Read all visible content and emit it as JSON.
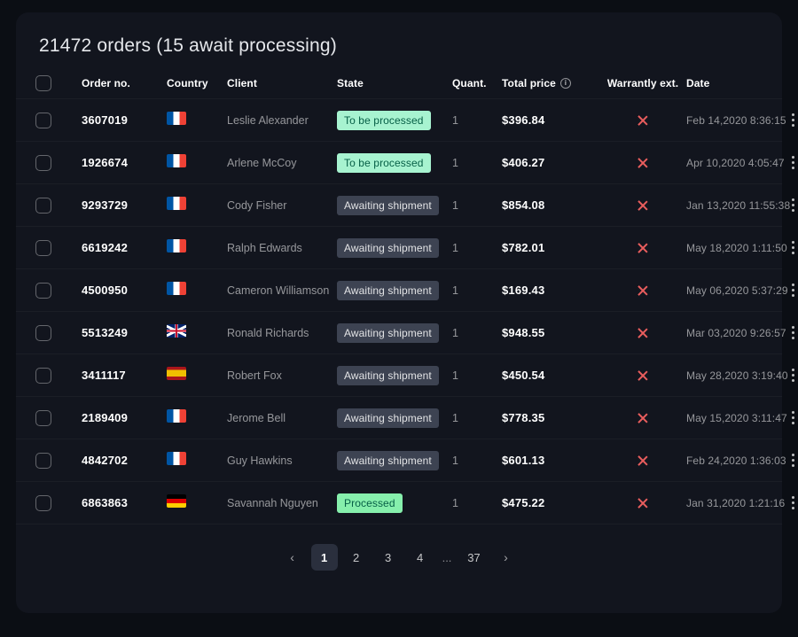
{
  "title": "21472 orders (15 await processing)",
  "columns": {
    "order_no": "Order no.",
    "country": "Country",
    "client": "Client",
    "state": "State",
    "quant": "Quant.",
    "total_price": "Total price",
    "warranty": "Warrantly ext.",
    "date": "Date"
  },
  "state_labels": {
    "to_be_processed": "To be processed",
    "awaiting": "Awaiting shipment",
    "processed": "Processed"
  },
  "rows": [
    {
      "order_no": "3607019",
      "country": "fr",
      "client": "Leslie Alexander",
      "state": "to_be_processed",
      "quant": "1",
      "price": "$396.84",
      "warranty": false,
      "date": "Feb 14,2020 8:36:15"
    },
    {
      "order_no": "1926674",
      "country": "fr",
      "client": "Arlene McCoy",
      "state": "to_be_processed",
      "quant": "1",
      "price": "$406.27",
      "warranty": false,
      "date": "Apr 10,2020 4:05:47"
    },
    {
      "order_no": "9293729",
      "country": "fr",
      "client": "Cody Fisher",
      "state": "awaiting",
      "quant": "1",
      "price": "$854.08",
      "warranty": false,
      "date": "Jan 13,2020 11:55:38"
    },
    {
      "order_no": "6619242",
      "country": "fr",
      "client": "Ralph Edwards",
      "state": "awaiting",
      "quant": "1",
      "price": "$782.01",
      "warranty": false,
      "date": "May 18,2020 1:11:50"
    },
    {
      "order_no": "4500950",
      "country": "fr",
      "client": "Cameron Williamson",
      "state": "awaiting",
      "quant": "1",
      "price": "$169.43",
      "warranty": false,
      "date": "May 06,2020 5:37:29"
    },
    {
      "order_no": "5513249",
      "country": "gb",
      "client": "Ronald Richards",
      "state": "awaiting",
      "quant": "1",
      "price": "$948.55",
      "warranty": false,
      "date": "Mar 03,2020 9:26:57"
    },
    {
      "order_no": "3411117",
      "country": "es",
      "client": "Robert Fox",
      "state": "awaiting",
      "quant": "1",
      "price": "$450.54",
      "warranty": false,
      "date": "May 28,2020 3:19:40"
    },
    {
      "order_no": "2189409",
      "country": "fr",
      "client": "Jerome Bell",
      "state": "awaiting",
      "quant": "1",
      "price": "$778.35",
      "warranty": false,
      "date": "May 15,2020 3:11:47"
    },
    {
      "order_no": "4842702",
      "country": "fr",
      "client": "Guy Hawkins",
      "state": "awaiting",
      "quant": "1",
      "price": "$601.13",
      "warranty": false,
      "date": "Feb 24,2020 1:36:03"
    },
    {
      "order_no": "6863863",
      "country": "de",
      "client": "Savannah Nguyen",
      "state": "processed",
      "quant": "1",
      "price": "$475.22",
      "warranty": false,
      "date": "Jan 31,2020 1:21:16"
    }
  ],
  "pagination": {
    "pages": [
      "1",
      "2",
      "3",
      "4"
    ],
    "ellipsis": "...",
    "last": "37",
    "active": "1"
  }
}
